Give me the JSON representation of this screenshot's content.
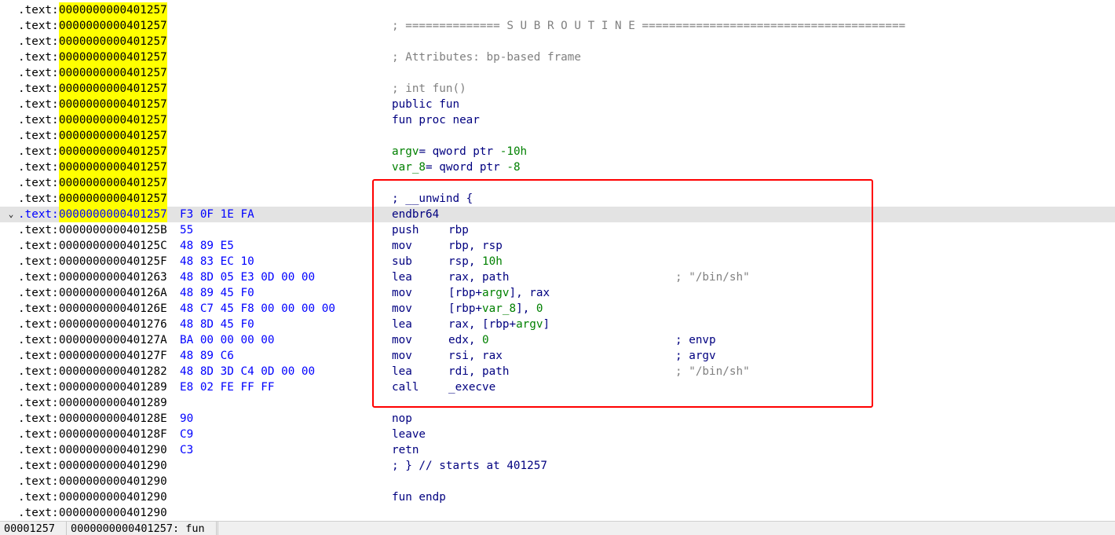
{
  "segment": ".text:",
  "collapse_glyph": "⌄",
  "lines": [
    {
      "addr": "0000000000401257",
      "hl": true,
      "bytes": "",
      "code": [
        {
          "t": "",
          "c": ""
        }
      ]
    },
    {
      "addr": "0000000000401257",
      "hl": true,
      "bytes": "",
      "code": [
        {
          "t": "; ============== S U B R O U T I N E =======================================",
          "c": "cm"
        }
      ]
    },
    {
      "addr": "0000000000401257",
      "hl": true,
      "bytes": "",
      "code": [
        {
          "t": "",
          "c": ""
        }
      ]
    },
    {
      "addr": "0000000000401257",
      "hl": true,
      "bytes": "",
      "code": [
        {
          "t": "; Attributes: bp-based frame",
          "c": "cm"
        }
      ]
    },
    {
      "addr": "0000000000401257",
      "hl": true,
      "bytes": "",
      "code": [
        {
          "t": "",
          "c": ""
        }
      ]
    },
    {
      "addr": "0000000000401257",
      "hl": true,
      "bytes": "",
      "code": [
        {
          "t": "; int fun()",
          "c": "cm"
        }
      ]
    },
    {
      "addr": "0000000000401257",
      "hl": true,
      "bytes": "",
      "code": [
        {
          "t": "public fun",
          "c": "op"
        }
      ]
    },
    {
      "addr": "0000000000401257",
      "hl": true,
      "bytes": "",
      "code": [
        {
          "t": "fun proc near",
          "c": "op"
        }
      ]
    },
    {
      "addr": "0000000000401257",
      "hl": true,
      "bytes": "",
      "code": [
        {
          "t": "",
          "c": ""
        }
      ]
    },
    {
      "addr": "0000000000401257",
      "hl": true,
      "bytes": "",
      "code": [
        {
          "t": "argv",
          "c": "lv"
        },
        {
          "t": "= qword ptr ",
          "c": "op"
        },
        {
          "t": "-10h",
          "c": "nm"
        }
      ]
    },
    {
      "addr": "0000000000401257",
      "hl": true,
      "bytes": "",
      "code": [
        {
          "t": "var_8",
          "c": "lv"
        },
        {
          "t": "= qword ptr ",
          "c": "op"
        },
        {
          "t": "-8",
          "c": "nm"
        }
      ]
    },
    {
      "addr": "0000000000401257",
      "hl": true,
      "bytes": "",
      "code": [
        {
          "t": "",
          "c": ""
        }
      ]
    },
    {
      "addr": "0000000000401257",
      "hl": true,
      "bytes": "",
      "code": [
        {
          "t": "; __unwind {",
          "c": "op"
        }
      ]
    },
    {
      "addr": "0000000000401257",
      "hl": true,
      "current": true,
      "bytes": "F3 0F 1E FA",
      "mn": "endbr64",
      "code": []
    },
    {
      "addr": "000000000040125B",
      "bytes": "55",
      "mn": "push",
      "code": [
        {
          "t": "rbp",
          "c": "op"
        }
      ]
    },
    {
      "addr": "000000000040125C",
      "bytes": "48 89 E5",
      "mn": "mov",
      "code": [
        {
          "t": "rbp, rsp",
          "c": "op"
        }
      ]
    },
    {
      "addr": "000000000040125F",
      "bytes": "48 83 EC 10",
      "mn": "sub",
      "code": [
        {
          "t": "rsp, ",
          "c": "op"
        },
        {
          "t": "10h",
          "c": "nm"
        }
      ]
    },
    {
      "addr": "0000000000401263",
      "bytes": "48 8D 05 E3 0D 00 00",
      "mn": "lea",
      "code": [
        {
          "t": "rax, path",
          "c": "op"
        }
      ],
      "cmt": "; \"/bin/sh\"",
      "cmt_c": "cm"
    },
    {
      "addr": "000000000040126A",
      "bytes": "48 89 45 F0",
      "mn": "mov",
      "code": [
        {
          "t": "[rbp+",
          "c": "op"
        },
        {
          "t": "argv",
          "c": "lv"
        },
        {
          "t": "], rax",
          "c": "op"
        }
      ]
    },
    {
      "addr": "000000000040126E",
      "bytes": "48 C7 45 F8 00 00 00 00",
      "mn": "mov",
      "code": [
        {
          "t": "[rbp+",
          "c": "op"
        },
        {
          "t": "var_8",
          "c": "lv"
        },
        {
          "t": "], ",
          "c": "op"
        },
        {
          "t": "0",
          "c": "nm"
        }
      ]
    },
    {
      "addr": "0000000000401276",
      "bytes": "48 8D 45 F0",
      "mn": "lea",
      "code": [
        {
          "t": "rax, [rbp+",
          "c": "op"
        },
        {
          "t": "argv",
          "c": "lv"
        },
        {
          "t": "]",
          "c": "op"
        }
      ]
    },
    {
      "addr": "000000000040127A",
      "bytes": "BA 00 00 00 00",
      "mn": "mov",
      "code": [
        {
          "t": "edx, ",
          "c": "op"
        },
        {
          "t": "0",
          "c": "nm"
        }
      ],
      "cmt": "; envp",
      "cmt_c": "op"
    },
    {
      "addr": "000000000040127F",
      "bytes": "48 89 C6",
      "mn": "mov",
      "code": [
        {
          "t": "rsi, rax",
          "c": "op"
        }
      ],
      "cmt": "; argv",
      "cmt_c": "op"
    },
    {
      "addr": "0000000000401282",
      "bytes": "48 8D 3D C4 0D 00 00",
      "mn": "lea",
      "code": [
        {
          "t": "rdi, path",
          "c": "op"
        }
      ],
      "cmt": "; \"/bin/sh\"",
      "cmt_c": "cm"
    },
    {
      "addr": "0000000000401289",
      "bytes": "E8 02 FE FF FF",
      "mn": "call",
      "code": [
        {
          "t": "_execve",
          "c": "op"
        }
      ]
    },
    {
      "addr": "0000000000401289",
      "bytes": "",
      "code": [
        {
          "t": "",
          "c": ""
        }
      ]
    },
    {
      "addr": "000000000040128E",
      "bytes": "90",
      "mn": "nop",
      "code": []
    },
    {
      "addr": "000000000040128F",
      "bytes": "C9",
      "mn": "leave",
      "code": []
    },
    {
      "addr": "0000000000401290",
      "bytes": "C3",
      "mn": "retn",
      "code": []
    },
    {
      "addr": "0000000000401290",
      "bytes": "",
      "code": [
        {
          "t": "; } // starts at 401257",
          "c": "op"
        }
      ]
    },
    {
      "addr": "0000000000401290",
      "bytes": "",
      "code": [
        {
          "t": "",
          "c": ""
        }
      ]
    },
    {
      "addr": "0000000000401290",
      "bytes": "",
      "code": [
        {
          "t": "fun endp",
          "c": "op"
        }
      ]
    },
    {
      "addr": "0000000000401290",
      "bytes": "",
      "code": [
        {
          "t": "",
          "c": ""
        }
      ]
    }
  ],
  "status": {
    "offset": "00001257",
    "location": "0000000000401257: fun"
  },
  "colors": {
    "address_highlight": "#ffff00",
    "current_line": "#e3e3e3",
    "annotation_box": "#ff0000",
    "code_text": "#000080",
    "bytes_text": "#0000ff",
    "number_text": "#008000",
    "comment_text": "#808080"
  }
}
